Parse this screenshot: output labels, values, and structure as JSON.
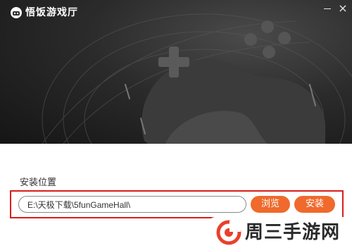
{
  "window": {
    "app_title": "悟饭游戏厅",
    "minimize_icon": "minimize-icon",
    "close_icon": "close-icon",
    "close_glyph": "×"
  },
  "install": {
    "location_label": "安装位置",
    "path_value": "E:\\天极下载\\5funGameHall\\",
    "browse_label": "浏览",
    "install_label": "安装"
  },
  "watermark": {
    "text": "周三手游网"
  },
  "colors": {
    "accent": "#ef6a2c",
    "highlight": "#d81e1e",
    "hero_dark": "#1e1e1e"
  }
}
